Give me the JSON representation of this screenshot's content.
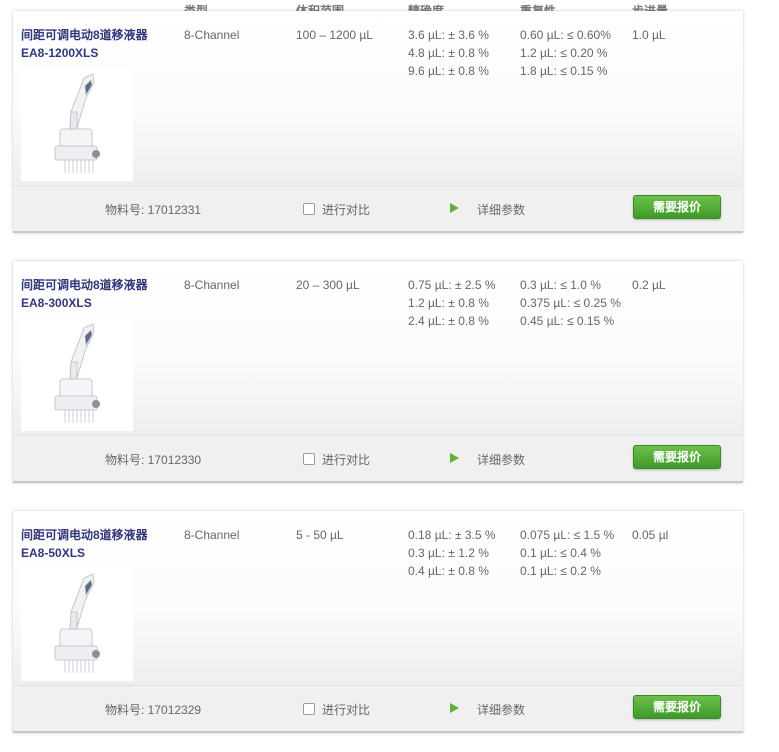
{
  "headers": [
    "类型",
    "体积范围",
    "精确度",
    "重复性",
    "步进量"
  ],
  "products": [
    {
      "name": "间距可调电动8道移液器",
      "model": "EA8-1200XLS",
      "type": "8-Channel",
      "volume": "100 – 1200 µL",
      "accuracy": [
        "3.6 µL: ± 3.6 %",
        "4.8 µL: ± 0.8 %",
        "9.6 µL: ± 0.8 %"
      ],
      "repeatability": [
        "0.60 µL: ≤ 0.60%",
        "1.2 µL: ≤ 0.20 %",
        "1.8 µL: ≤ 0.15 %"
      ],
      "step": "1.0 µL",
      "part_number": "物料号: 17012331",
      "compare_label": "进行对比",
      "details_label": "详细参数",
      "quote_label": "需要报价"
    },
    {
      "name": "间距可调电动8道移液器",
      "model": "EA8-300XLS",
      "type": "8-Channel",
      "volume": "20 – 300 µL",
      "accuracy": [
        "0.75 µL: ± 2.5 %",
        "1.2 µL: ± 0.8 %",
        "2.4 µL: ± 0.8 %"
      ],
      "repeatability": [
        "0.3 µL: ≤ 1.0 %",
        "0.375 µL: ≤ 0.25 %",
        "0.45 µL: ≤ 0.15 %"
      ],
      "step": "0.2 µL",
      "part_number": "物料号: 17012330",
      "compare_label": "进行对比",
      "details_label": "详细参数",
      "quote_label": "需要报价"
    },
    {
      "name": "间距可调电动8道移液器",
      "model": "EA8-50XLS",
      "type": "8-Channel",
      "volume": "5 - 50 µL",
      "accuracy": [
        "0.18 µL: ± 3.5 %",
        "0.3 µL: ± 1.2 %",
        "0.4 µL: ± 0.8 %"
      ],
      "repeatability": [
        "0.075 µL: ≤ 1.5 %",
        "0.1 µL: ≤ 0.4 %",
        "0.1 µL: ≤ 0.2 %"
      ],
      "step": "0.05 µl",
      "part_number": "物料号: 17012329",
      "compare_label": "进行对比",
      "details_label": "详细参数",
      "quote_label": "需要报价"
    }
  ],
  "colors": {
    "title": "#32377a",
    "quote_button": "#4caf35",
    "text": "#666666"
  },
  "icons": {
    "details": "play-triangle-icon",
    "image": "electronic-pipette-image"
  }
}
